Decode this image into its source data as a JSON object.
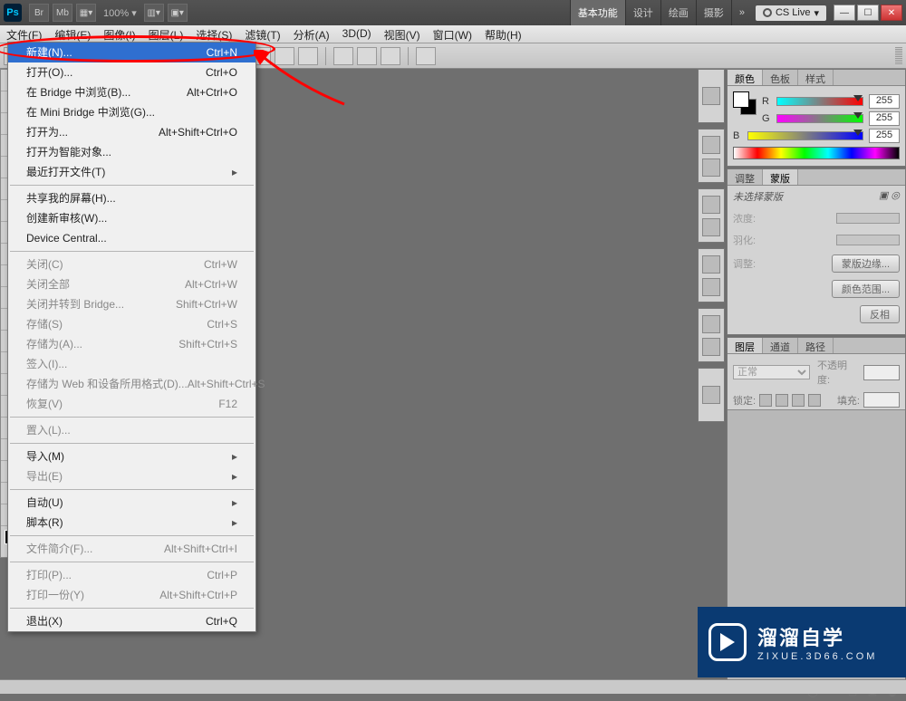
{
  "appbar": {
    "logo": "Ps",
    "zoom": "100%",
    "workspaces": [
      "基本功能",
      "设计",
      "绘画",
      "摄影"
    ],
    "active_workspace": 0,
    "cslive": "CS Live"
  },
  "menubar": [
    "文件(F)",
    "编辑(E)",
    "图像(I)",
    "图层(L)",
    "选择(S)",
    "滤镜(T)",
    "分析(A)",
    "3D(D)",
    "视图(V)",
    "窗口(W)",
    "帮助(H)"
  ],
  "file_menu": {
    "groups": [
      [
        {
          "label": "新建(N)...",
          "shortcut": "Ctrl+N",
          "selected": true
        },
        {
          "label": "打开(O)...",
          "shortcut": "Ctrl+O"
        },
        {
          "label": "在 Bridge 中浏览(B)...",
          "shortcut": "Alt+Ctrl+O"
        },
        {
          "label": "在 Mini Bridge 中浏览(G)..."
        },
        {
          "label": "打开为...",
          "shortcut": "Alt+Shift+Ctrl+O"
        },
        {
          "label": "打开为智能对象..."
        },
        {
          "label": "最近打开文件(T)",
          "sub": true
        }
      ],
      [
        {
          "label": "共享我的屏幕(H)..."
        },
        {
          "label": "创建新审核(W)..."
        },
        {
          "label": "Device Central..."
        }
      ],
      [
        {
          "label": "关闭(C)",
          "shortcut": "Ctrl+W",
          "dis": true
        },
        {
          "label": "关闭全部",
          "shortcut": "Alt+Ctrl+W",
          "dis": true
        },
        {
          "label": "关闭并转到 Bridge...",
          "shortcut": "Shift+Ctrl+W",
          "dis": true
        },
        {
          "label": "存储(S)",
          "shortcut": "Ctrl+S",
          "dis": true
        },
        {
          "label": "存储为(A)...",
          "shortcut": "Shift+Ctrl+S",
          "dis": true
        },
        {
          "label": "签入(I)...",
          "dis": true
        },
        {
          "label": "存储为 Web 和设备所用格式(D)...",
          "shortcut": "Alt+Shift+Ctrl+S",
          "dis": true
        },
        {
          "label": "恢复(V)",
          "shortcut": "F12",
          "dis": true
        }
      ],
      [
        {
          "label": "置入(L)...",
          "dis": true
        }
      ],
      [
        {
          "label": "导入(M)",
          "sub": true
        },
        {
          "label": "导出(E)",
          "sub": true,
          "dis": true
        }
      ],
      [
        {
          "label": "自动(U)",
          "sub": true
        },
        {
          "label": "脚本(R)",
          "sub": true
        }
      ],
      [
        {
          "label": "文件简介(F)...",
          "shortcut": "Alt+Shift+Ctrl+I",
          "dis": true
        }
      ],
      [
        {
          "label": "打印(P)...",
          "shortcut": "Ctrl+P",
          "dis": true
        },
        {
          "label": "打印一份(Y)",
          "shortcut": "Alt+Shift+Ctrl+P",
          "dis": true
        }
      ],
      [
        {
          "label": "退出(X)",
          "shortcut": "Ctrl+Q"
        }
      ]
    ]
  },
  "color_panel": {
    "tabs": [
      "颜色",
      "色板",
      "样式"
    ],
    "active": 0,
    "channels": [
      {
        "name": "R",
        "value": "255"
      },
      {
        "name": "G",
        "value": "255"
      },
      {
        "name": "B",
        "value": "255"
      }
    ]
  },
  "mask_panel": {
    "tabs": [
      "调整",
      "蒙版"
    ],
    "active": 1,
    "message": "未选择蒙版",
    "rows": {
      "density": "浓度:",
      "feather": "羽化:",
      "refine": "调整:",
      "btn_edge": "蒙版边缘...",
      "btn_range": "颜色范围...",
      "btn_invert": "反相"
    }
  },
  "layers_panel": {
    "tabs": [
      "图层",
      "通道",
      "路径"
    ],
    "active": 0,
    "blend": "正常",
    "opacity_label": "不透明度:",
    "lock_label": "锁定:",
    "fill_label": "填充:"
  },
  "watermark": {
    "cn": "溜溜自学",
    "en": "ZIXUE.3D66.COM"
  }
}
